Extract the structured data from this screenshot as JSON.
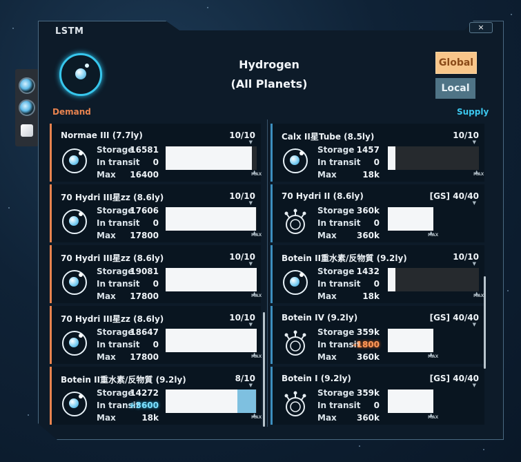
{
  "window": {
    "title": "LSTM",
    "close_label": "×"
  },
  "resource": {
    "name": "Hydrogen",
    "scope": "(All Planets)"
  },
  "filters": {
    "global": "Global",
    "local": "Local"
  },
  "sections": {
    "demand": "Demand",
    "supply": "Supply"
  },
  "labels": {
    "storage": "Storage",
    "in_transit": "In transit",
    "max": "Max",
    "max_tag": "MAX"
  },
  "demand": [
    {
      "name": "Normae III  (7.7ly)",
      "count": "10/10",
      "storage": "16581",
      "in_transit": "0",
      "max": "16400",
      "fill": 0.95,
      "transit_fill": 0,
      "icon": "orbital-station-icon"
    },
    {
      "name": "70 Hydri III星zz  (8.6ly)",
      "count": "10/10",
      "storage": "17606",
      "in_transit": "0",
      "max": "17800",
      "fill": 0.99,
      "transit_fill": 0,
      "icon": "orbital-station-icon"
    },
    {
      "name": "70 Hydri III星zz  (8.6ly)",
      "count": "10/10",
      "storage": "19081",
      "in_transit": "0",
      "max": "17800",
      "fill": 1.0,
      "transit_fill": 0,
      "icon": "orbital-station-icon"
    },
    {
      "name": "70 Hydri III星zz  (8.6ly)",
      "count": "10/10",
      "storage": "18647",
      "in_transit": "0",
      "max": "17800",
      "fill": 1.0,
      "transit_fill": 0,
      "icon": "orbital-station-icon"
    },
    {
      "name": "Botein II重水素/反物質  (9.2ly)",
      "count": "8/10",
      "storage": "14272",
      "in_transit": "+3600",
      "max": "18k",
      "fill": 0.79,
      "transit_fill": 0.2,
      "icon": "orbital-station-icon"
    }
  ],
  "supply": [
    {
      "name": "Calx II星Tube  (8.5ly)",
      "count": "10/10",
      "storage": "1457",
      "in_transit": "0",
      "max": "18k",
      "fill": 0.08,
      "icon": "orbital-station-icon",
      "wide": true
    },
    {
      "name": "70 Hydri II  (8.6ly)",
      "count": "[GS] 40/40",
      "storage": "360k",
      "in_transit": "0",
      "max": "360k",
      "fill": 1.0,
      "icon": "gas-giant-station-icon",
      "wide": false
    },
    {
      "name": "Botein II重水素/反物質  (9.2ly)",
      "count": "10/10",
      "storage": "1432",
      "in_transit": "0",
      "max": "18k",
      "fill": 0.08,
      "icon": "orbital-station-icon",
      "wide": true
    },
    {
      "name": "Botein IV  (9.2ly)",
      "count": "[GS] 40/40",
      "storage": "359k",
      "in_transit": "-1800",
      "max": "360k",
      "fill": 1.0,
      "icon": "gas-giant-station-icon",
      "wide": false
    },
    {
      "name": "Botein I  (9.2ly)",
      "count": "[GS] 40/40",
      "storage": "359k",
      "in_transit": "0",
      "max": "360k",
      "fill": 1.0,
      "icon": "gas-giant-station-icon",
      "wide": false
    }
  ],
  "colors": {
    "demand_accent": "#e8834f",
    "supply_accent": "#3d8fbf",
    "highlight": "#37c6ec",
    "global_btn": "#f8c68a",
    "local_btn": "#4f7486"
  }
}
